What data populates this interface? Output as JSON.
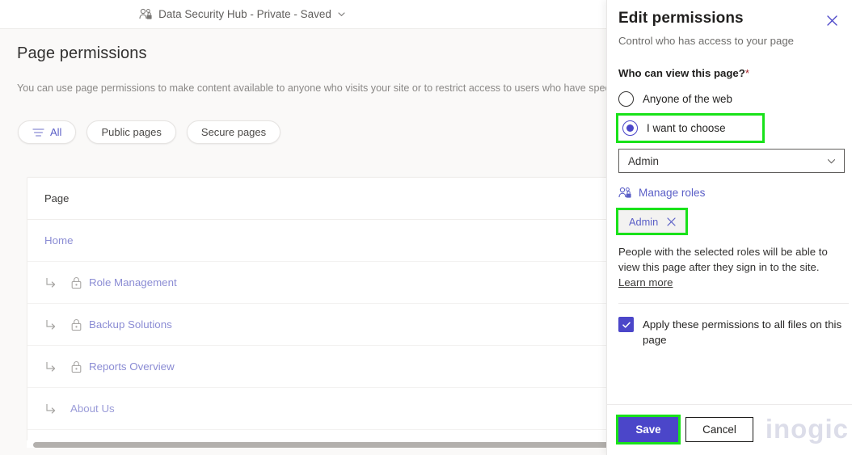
{
  "topbar": {
    "site_icon": "people-lock-icon",
    "title": "Data Security Hub - Private - Saved",
    "chevron_icon": "chevron-down-icon"
  },
  "page": {
    "title": "Page permissions",
    "description": "You can use page permissions to make content available to anyone who visits your site or to restrict access to users who have speci"
  },
  "filters": {
    "items": [
      {
        "label": "All",
        "icon": "filter-icon",
        "active": true
      },
      {
        "label": "Public pages",
        "active": false
      },
      {
        "label": "Secure pages",
        "active": false
      }
    ]
  },
  "table": {
    "column_header": "Page",
    "rows": [
      {
        "label": "Home",
        "nested": false,
        "locked": false
      },
      {
        "label": "Role Management",
        "nested": true,
        "locked": true
      },
      {
        "label": "Backup Solutions",
        "nested": true,
        "locked": true
      },
      {
        "label": "Reports Overview",
        "nested": true,
        "locked": true
      },
      {
        "label": "About Us",
        "nested": true,
        "locked": false
      }
    ]
  },
  "panel": {
    "title": "Edit permissions",
    "subtitle": "Control who has access to your page",
    "close_icon": "close-icon",
    "question_label": "Who can view this page?",
    "required_marker": "*",
    "radios": [
      {
        "label": "Anyone of the web",
        "selected": false,
        "highlighted": false
      },
      {
        "label": "I want to choose",
        "selected": true,
        "highlighted": true
      }
    ],
    "role_select": {
      "value": "Admin",
      "chevron_icon": "chevron-down-icon"
    },
    "manage_roles": {
      "label": "Manage roles",
      "icon": "people-lock-icon"
    },
    "tag": {
      "label": "Admin",
      "remove_icon": "close-icon",
      "highlighted": true
    },
    "helper_text": "People with the selected roles will be able to view this page after they sign in to the site.",
    "learn_more_label": "Learn more",
    "apply_checkbox": {
      "label": "Apply these permissions to all files on this page",
      "checked": true,
      "icon": "check-icon"
    },
    "footer": {
      "save_label": "Save",
      "save_highlighted": true,
      "cancel_label": "Cancel"
    }
  },
  "watermark": {
    "text": "inogic"
  },
  "colors": {
    "accent_purple": "#4b46c9",
    "link_purple": "#5b5fc7",
    "highlight_green": "#19e21a",
    "required_red": "#a4262c",
    "table_link": "#8b8cd4"
  }
}
